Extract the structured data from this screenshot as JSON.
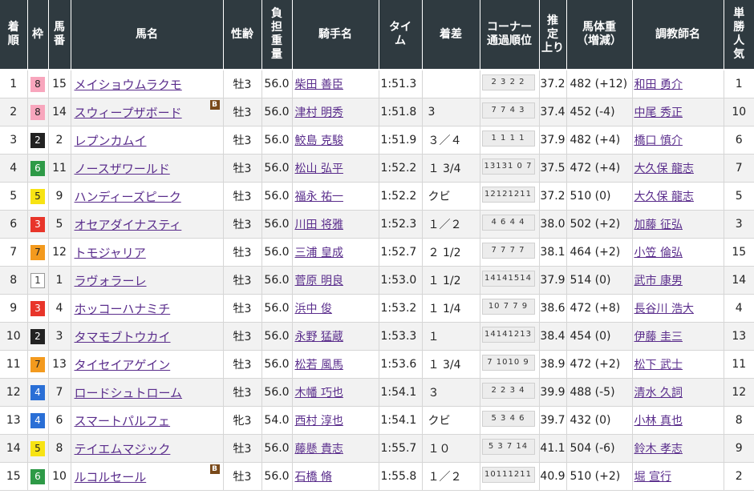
{
  "headers": {
    "rank": [
      "着",
      "順"
    ],
    "waku": [
      "枠"
    ],
    "umaban": [
      "馬",
      "番"
    ],
    "horse": [
      "馬名"
    ],
    "sexage": [
      "性齢"
    ],
    "load": [
      "負",
      "担",
      "重",
      "量"
    ],
    "jockey": [
      "騎手名"
    ],
    "time": [
      "タイ",
      "ム"
    ],
    "margin": [
      "着差"
    ],
    "corner": [
      "コーナー",
      "通過順位"
    ],
    "last3f": [
      "推",
      "定",
      "上り"
    ],
    "weight": [
      "馬体重",
      "（増減）"
    ],
    "trainer": [
      "調教師名"
    ],
    "pop": [
      "単",
      "勝",
      "人",
      "気"
    ]
  },
  "colors": {
    "header_bg": "#2f3a40",
    "link": "#5a2d8c",
    "waku": {
      "1": {
        "bg": "#ffffff",
        "fg": "#333333",
        "border": "#999999"
      },
      "2": {
        "bg": "#222222",
        "fg": "#ffffff",
        "border": "#222222"
      },
      "3": {
        "bg": "#e8352a",
        "fg": "#ffffff",
        "border": "#e8352a"
      },
      "4": {
        "bg": "#2a6fd6",
        "fg": "#ffffff",
        "border": "#2a6fd6"
      },
      "5": {
        "bg": "#f7e313",
        "fg": "#222222",
        "border": "#f7e313"
      },
      "6": {
        "bg": "#2e9a47",
        "fg": "#ffffff",
        "border": "#2e9a47"
      },
      "7": {
        "bg": "#f39a1e",
        "fg": "#222222",
        "border": "#f39a1e"
      },
      "8": {
        "bg": "#f8a6bd",
        "fg": "#222222",
        "border": "#f8a6bd"
      }
    }
  },
  "blinker_label": "B",
  "rows": [
    {
      "rank": "1",
      "waku": "8",
      "umaban": "15",
      "horse": "メイショウムラクモ",
      "blinker": false,
      "sexage": "牡3",
      "load": "56.0",
      "jockey": "柴田 善臣",
      "time": "1:51.3",
      "margin": "",
      "corner": "2 3 2 2",
      "last3f": "37.2",
      "weight": "482 (+12)",
      "trainer": "和田 勇介",
      "pop": "1"
    },
    {
      "rank": "2",
      "waku": "8",
      "umaban": "14",
      "horse": "スウィープザボード",
      "blinker": true,
      "sexage": "牡3",
      "load": "56.0",
      "jockey": "津村 明秀",
      "time": "1:51.8",
      "margin": "3",
      "corner": "7 7 4 3",
      "last3f": "37.4",
      "weight": "452 (-4)",
      "trainer": "中尾 秀正",
      "pop": "10"
    },
    {
      "rank": "3",
      "waku": "2",
      "umaban": "2",
      "horse": "レプンカムイ",
      "blinker": false,
      "sexage": "牡3",
      "load": "56.0",
      "jockey": "鮫島 克駿",
      "time": "1:51.9",
      "margin": "３／４",
      "corner": "1 1 1 1",
      "last3f": "37.9",
      "weight": "482 (+4)",
      "trainer": "橋口 慎介",
      "pop": "6"
    },
    {
      "rank": "4",
      "waku": "6",
      "umaban": "11",
      "horse": "ノースザワールド",
      "blinker": false,
      "sexage": "牡3",
      "load": "56.0",
      "jockey": "松山 弘平",
      "time": "1:52.2",
      "margin": "１ 3/4",
      "corner": "13131 0 7",
      "last3f": "37.5",
      "weight": "472 (+4)",
      "trainer": "大久保 龍志",
      "pop": "7"
    },
    {
      "rank": "5",
      "waku": "5",
      "umaban": "9",
      "horse": "ハンディーズピーク",
      "blinker": false,
      "sexage": "牡3",
      "load": "56.0",
      "jockey": "福永 祐一",
      "time": "1:52.2",
      "margin": "クビ",
      "corner": "12121211",
      "last3f": "37.2",
      "weight": "510 (0)",
      "trainer": "大久保 龍志",
      "pop": "5"
    },
    {
      "rank": "6",
      "waku": "3",
      "umaban": "5",
      "horse": "オセアダイナスティ",
      "blinker": false,
      "sexage": "牡3",
      "load": "56.0",
      "jockey": "川田 将雅",
      "time": "1:52.3",
      "margin": "１／２",
      "corner": "4 6 4 4",
      "last3f": "38.0",
      "weight": "502 (+2)",
      "trainer": "加藤 征弘",
      "pop": "3"
    },
    {
      "rank": "7",
      "waku": "7",
      "umaban": "12",
      "horse": "トモジャリア",
      "blinker": false,
      "sexage": "牡3",
      "load": "56.0",
      "jockey": "三浦 皇成",
      "time": "1:52.7",
      "margin": "２ 1/2",
      "corner": "7 7 7 7",
      "last3f": "38.1",
      "weight": "464 (+2)",
      "trainer": "小笠 倫弘",
      "pop": "15"
    },
    {
      "rank": "8",
      "waku": "1",
      "umaban": "1",
      "horse": "ラヴォラーレ",
      "blinker": false,
      "sexage": "牡3",
      "load": "56.0",
      "jockey": "菅原 明良",
      "time": "1:53.0",
      "margin": "１ 1/2",
      "corner": "14141514",
      "last3f": "37.9",
      "weight": "514 (0)",
      "trainer": "武市 康男",
      "pop": "14"
    },
    {
      "rank": "9",
      "waku": "3",
      "umaban": "4",
      "horse": "ホッコーハナミチ",
      "blinker": false,
      "sexage": "牡3",
      "load": "56.0",
      "jockey": "浜中 俊",
      "time": "1:53.2",
      "margin": "１ 1/4",
      "corner": "10 7 7 9",
      "last3f": "38.6",
      "weight": "472 (+8)",
      "trainer": "長谷川 浩大",
      "pop": "4"
    },
    {
      "rank": "10",
      "waku": "2",
      "umaban": "3",
      "horse": "タマモブトウカイ",
      "blinker": false,
      "sexage": "牡3",
      "load": "56.0",
      "jockey": "永野 猛蔵",
      "time": "1:53.3",
      "margin": "１",
      "corner": "14141213",
      "last3f": "38.4",
      "weight": "454 (0)",
      "trainer": "伊藤 圭三",
      "pop": "13"
    },
    {
      "rank": "11",
      "waku": "7",
      "umaban": "13",
      "horse": "タイセイアゲイン",
      "blinker": false,
      "sexage": "牡3",
      "load": "56.0",
      "jockey": "松若 風馬",
      "time": "1:53.6",
      "margin": "１ 3/4",
      "corner": "7 1010 9",
      "last3f": "38.9",
      "weight": "472 (+2)",
      "trainer": "松下 武士",
      "pop": "11"
    },
    {
      "rank": "12",
      "waku": "4",
      "umaban": "7",
      "horse": "ロードシュトローム",
      "blinker": false,
      "sexage": "牡3",
      "load": "56.0",
      "jockey": "木幡 巧也",
      "time": "1:54.1",
      "margin": "３",
      "corner": "2 2 3 4",
      "last3f": "39.9",
      "weight": "488 (-5)",
      "trainer": "清水 久詞",
      "pop": "12"
    },
    {
      "rank": "13",
      "waku": "4",
      "umaban": "6",
      "horse": "スマートパルフェ",
      "blinker": false,
      "sexage": "牝3",
      "load": "54.0",
      "jockey": "西村 淳也",
      "time": "1:54.1",
      "margin": "クビ",
      "corner": "5 3 4 6",
      "last3f": "39.7",
      "weight": "432 (0)",
      "trainer": "小林 真也",
      "pop": "8"
    },
    {
      "rank": "14",
      "waku": "5",
      "umaban": "8",
      "horse": "テイエムマジック",
      "blinker": false,
      "sexage": "牡3",
      "load": "56.0",
      "jockey": "藤懸 貴志",
      "time": "1:55.7",
      "margin": "１０",
      "corner": "5 3 7 14",
      "last3f": "41.1",
      "weight": "504 (-6)",
      "trainer": "鈴木 孝志",
      "pop": "9"
    },
    {
      "rank": "15",
      "waku": "6",
      "umaban": "10",
      "horse": "ルコルセール",
      "blinker": true,
      "sexage": "牡3",
      "load": "56.0",
      "jockey": "石橋 脩",
      "time": "1:55.8",
      "margin": "１／２",
      "corner": "10111211",
      "last3f": "40.9",
      "weight": "510 (+2)",
      "trainer": "堀 宣行",
      "pop": "2"
    }
  ]
}
